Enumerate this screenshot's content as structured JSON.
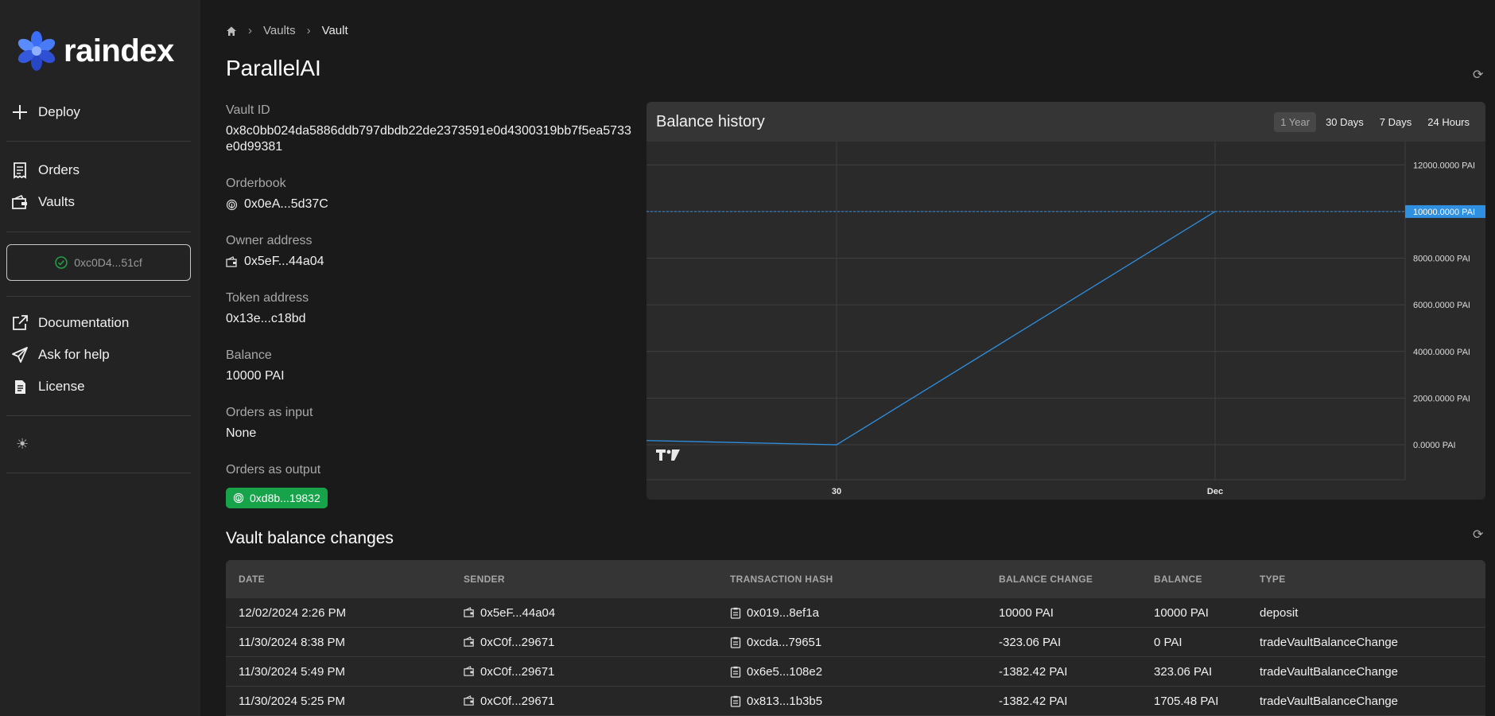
{
  "app": {
    "logo_text": "raindex"
  },
  "sidebar": {
    "deploy": "Deploy",
    "orders": "Orders",
    "vaults": "Vaults",
    "wallet": "0xc0D4...51cf",
    "documentation": "Documentation",
    "help": "Ask for help",
    "license": "License"
  },
  "breadcrumb": {
    "vaults": "Vaults",
    "current": "Vault"
  },
  "page": {
    "title": "ParallelAI"
  },
  "details": {
    "vault_id_label": "Vault ID",
    "vault_id": "0x8c0bb024da5886ddb797dbdb22de2373591e0d4300319bb7f5ea5733e0d99381",
    "orderbook_label": "Orderbook",
    "orderbook": "0x0eA...5d37C",
    "owner_label": "Owner address",
    "owner": "0x5eF...44a04",
    "token_label": "Token address",
    "token": "0x13e...c18bd",
    "balance_label": "Balance",
    "balance": "10000 PAI",
    "orders_input_label": "Orders as input",
    "orders_input": "None",
    "orders_output_label": "Orders as output",
    "orders_output": "0xd8b...19832"
  },
  "chart_header": {
    "title": "Balance history",
    "ranges": [
      "1 Year",
      "30 Days",
      "7 Days",
      "24 Hours"
    ],
    "active_range": "1 Year"
  },
  "chart_data": {
    "type": "line",
    "title": "Balance history",
    "x": [
      "",
      "30",
      "Dec"
    ],
    "series": [
      {
        "values": [
          180,
          0,
          10000
        ]
      }
    ],
    "y_ticks": [
      "12000.0000 PAI",
      "10000.0000 PAI",
      "8000.0000 PAI",
      "6000.0000 PAI",
      "4000.0000 PAI",
      "2000.0000 PAI",
      "0.0000 PAI"
    ],
    "x_ticks": [
      "30",
      "Dec"
    ],
    "ylim": [
      -1500,
      13000
    ],
    "current_label": "10000.0000 PAI",
    "line_color": "#2f8fe0",
    "grid": true
  },
  "table": {
    "title": "Vault balance changes",
    "headers": [
      "DATE",
      "SENDER",
      "TRANSACTION HASH",
      "BALANCE CHANGE",
      "BALANCE",
      "TYPE"
    ],
    "rows": [
      [
        "12/02/2024 2:26 PM",
        "0x5eF...44a04",
        "0x019...8ef1a",
        "10000 PAI",
        "10000 PAI",
        "deposit"
      ],
      [
        "11/30/2024 8:38 PM",
        "0xC0f...29671",
        "0xcda...79651",
        "-323.06 PAI",
        "0 PAI",
        "tradeVaultBalanceChange"
      ],
      [
        "11/30/2024 5:49 PM",
        "0xC0f...29671",
        "0x6e5...108e2",
        "-1382.42 PAI",
        "323.06 PAI",
        "tradeVaultBalanceChange"
      ],
      [
        "11/30/2024 5:25 PM",
        "0xC0f...29671",
        "0x813...1b3b5",
        "-1382.42 PAI",
        "1705.48 PAI",
        "tradeVaultBalanceChange"
      ]
    ]
  }
}
